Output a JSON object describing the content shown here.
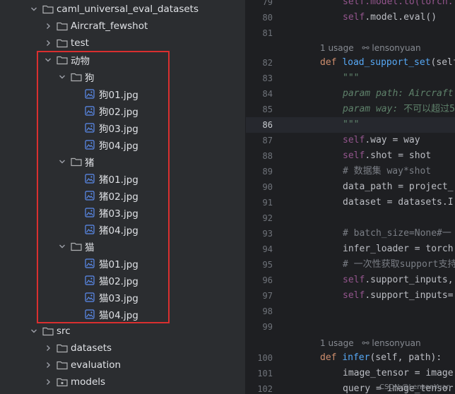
{
  "project_tree": {
    "root_folder": "caml_universal_eval_datasets",
    "aircraft_folder": "Aircraft_fewshot",
    "test_folder": "test",
    "animals_folder": "动物",
    "dog_folder": "狗",
    "dog_files": [
      "狗01.jpg",
      "狗02.jpg",
      "狗03.jpg",
      "狗04.jpg"
    ],
    "pig_folder": "猪",
    "pig_files": [
      "猪01.jpg",
      "猪02.jpg",
      "猪03.jpg",
      "猪04.jpg"
    ],
    "cat_folder": "猫",
    "cat_files": [
      "猫01.jpg",
      "猫02.jpg",
      "猫03.jpg",
      "猫04.jpg"
    ],
    "src_folder": "src",
    "datasets_folder": "datasets",
    "evaluation_folder": "evaluation",
    "models_folder": "models"
  },
  "editor": {
    "line_numbers": [
      "79",
      "80",
      "81",
      "82",
      "83",
      "84",
      "85",
      "86",
      "87",
      "88",
      "89",
      "90",
      "91",
      "92",
      "93",
      "94",
      "95",
      "96",
      "97",
      "98",
      "99",
      "100",
      "101",
      "102"
    ],
    "usage_hint_1": "1 usage",
    "author_1": "lensonyuan",
    "usage_hint_2": "1 usage",
    "author_2": "lensonyuan",
    "code": {
      "l79": "self.model.to(torch.",
      "l80a": "self",
      "l80b": ".model.eval()",
      "l82_def": "def ",
      "l82_fn": "load_support_set",
      "l82_rest": "(self",
      "l83": "\"\"\"",
      "l84": "param path: Aircraft",
      "l85a": "param way: ",
      "l85b": "不可以超过5",
      "l86": "\"\"\"",
      "l87a": "self",
      "l87b": ".way = way",
      "l88a": "self",
      "l88b": ".shot = shot",
      "l89": "# 数据集 way*shot",
      "l90": "data_path = project_",
      "l91": "dataset = datasets.I",
      "l93": "# batch_size=None#一",
      "l94": "infer_loader = torch",
      "l95": "# 一次性获取support支持",
      "l96a": "self",
      "l96b": ".support_inputs,",
      "l97a": "self",
      "l97b": ".support_inputs=",
      "l100_def": "def ",
      "l100_fn": "infer",
      "l100_rest": "(self, path):",
      "l101": "image_tensor = image",
      "l102": "query = image_tensor"
    }
  },
  "watermark": "CSDN @LensonYuan",
  "colors": {
    "highlight_border": "#d92f2f",
    "folder_icon": "#afb1b3",
    "image_icon": "#5b8def"
  }
}
